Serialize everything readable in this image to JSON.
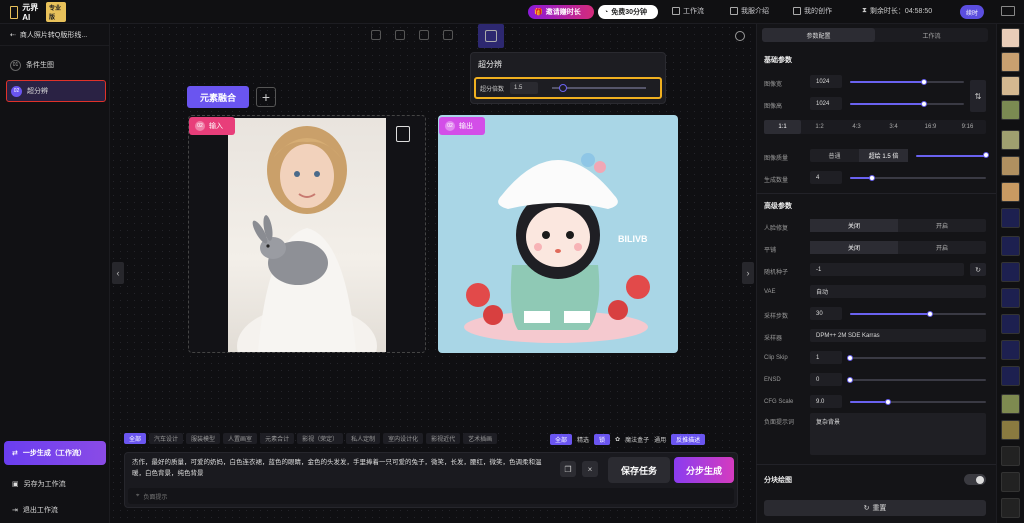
{
  "app": {
    "logo": "元界AI",
    "badge": "专业版"
  },
  "topbar": {
    "invite": "邀请赚时长",
    "free": "免费30分钟",
    "workflow": "工作流",
    "intro": "我服介绍",
    "works": "我的创作",
    "timer": "剩余时长：04:58:50",
    "member": "续时"
  },
  "left": {
    "project": "商人照片转Q版形线...",
    "steps": [
      {
        "num": "01",
        "label": "条件生图"
      },
      {
        "num": "02",
        "label": "超分辨"
      }
    ],
    "bottom": {
      "generate": "一步生成（工作流）",
      "save": "另存为工作流",
      "exit": "退出工作流"
    }
  },
  "popup": {
    "title": "超分辨",
    "row_label": "超分倍数",
    "row_value": "1.5"
  },
  "canvas": {
    "tag": "元素融合",
    "plus": "+",
    "input_badge": {
      "num": "02",
      "label": "输入"
    },
    "output_badge": {
      "num": "02",
      "label": "输出"
    },
    "watermark": "BILIVB"
  },
  "bottom": {
    "cats": [
      "全部",
      "汽车设计",
      "服装模型",
      "人置画室",
      "元素合计",
      "影视（荣定）",
      "私人定制",
      "室内设计化",
      "影视近代",
      "艺术插画"
    ],
    "controls": {
      "all": "全部",
      "sel": "精选",
      "lock": "锁",
      "modeltag": "魔法盒子",
      "use": "通用",
      "opt": "反推描述"
    },
    "prompt": "杰作，最好的质量，可爱的奶妈，白色连衣裙，蓝色的眼睛，金色的头发发，手里捧着一只可爱的兔子，微笑，长发，腰红，微笑，色调柔和温暖，白色背景，纯色背景",
    "neg_placeholder": "负面提示",
    "save": "保存任务",
    "gen": "分步生成"
  },
  "right": {
    "tabs": [
      "参数配置",
      "工作流"
    ],
    "basic": "基础参数",
    "width_label": "图像宽",
    "width": "1024",
    "height_label": "图像高",
    "height": "1024",
    "ratios": [
      "1:1",
      "1:2",
      "4:3",
      "3:4",
      "16:9",
      "9:16"
    ],
    "quality_label": "图像质量",
    "quality": [
      "普通",
      "超绘 1.5 倍"
    ],
    "count_label": "生成数量",
    "count": "4",
    "advanced": "高级参数",
    "face_label": "人脸修复",
    "face": [
      "关闭",
      "开启"
    ],
    "tile_label": "平铺",
    "tile": [
      "关闭",
      "开启"
    ],
    "seed_label": "随机种子",
    "seed": "-1",
    "vae_label": "VAE",
    "vae": "自动",
    "steps_label": "采样步数",
    "steps": "30",
    "sampler_label": "采样器",
    "sampler": "DPM++ 2M SDE Karras",
    "clip_label": "Clip Skip",
    "clip": "1",
    "ensd_label": "ENSD",
    "ensd": "0",
    "cfg_label": "CFG Scale",
    "cfg": "9.0",
    "neg_label": "负面提示词",
    "neg": "复杂背景",
    "tiles_label": "分块绘图",
    "reset": "重置"
  },
  "colors": {
    "accent": "#6a55f0",
    "highlight": "#e0322a",
    "popup_border": "#f0b020"
  }
}
